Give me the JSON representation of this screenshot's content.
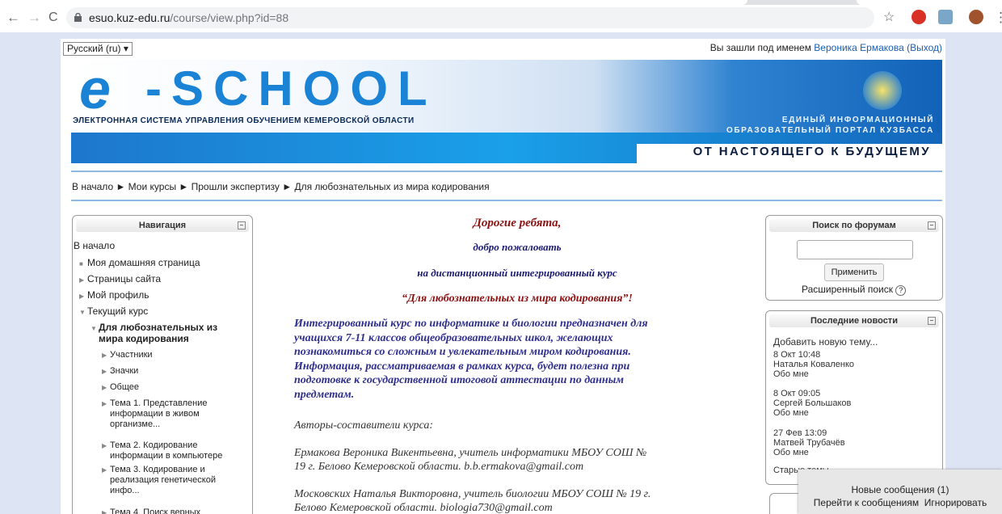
{
  "browser": {
    "url_host": "esuo.kuz-edu.ru",
    "url_path": "/course/view.php?id=88"
  },
  "lang_select": "Русский (ru) ▾",
  "login": {
    "prefix": "Вы зашли под именем ",
    "user": "Вероника Ермакова",
    "logout": "(Выход)"
  },
  "banner": {
    "e": "e",
    "school": "-SCHOOL",
    "subtitle": "ЭЛЕКТРОННАЯ СИСТЕМА УПРАВЛЕНИЯ ОБУЧЕНИЕМ КЕМЕРОВСКОЙ ОБЛАСТИ",
    "right1": "ЕДИНЫЙ ИНФОРМАЦИОННЫЙ",
    "right2": "ОБРАЗОВАТЕЛЬНЫЙ ПОРТАЛ КУЗБАССА",
    "slogan": "ОТ НАСТОЯЩЕГО К БУДУЩЕМУ"
  },
  "breadcrumb": [
    "В начало",
    "Мои курсы",
    "Прошли экспертизу",
    "Для любознательных из мира кодирования"
  ],
  "nav": {
    "title": "Навигация",
    "home": "В начало",
    "items": [
      "Моя домашняя страница",
      "Страницы сайта",
      "Мой профиль",
      "Текущий курс"
    ],
    "course_line1": "Для любознательных из",
    "course_line2": "мира кодирования",
    "sub": [
      "Участники",
      "Значки",
      "Общее"
    ],
    "t1": [
      "Тема 1. Представление",
      "информации в живом",
      "организме..."
    ],
    "t2": [
      "Тема 2. Кодирование",
      "информации в компьютере"
    ],
    "t3": [
      "Тема 3. Кодирование и",
      "реализация генетической",
      "инфо..."
    ],
    "t4": "Тема 4. Поиск верных"
  },
  "center": {
    "l1": "Дорогие ребята,",
    "l2": "добро пожаловать",
    "l3": "на дистанционный интегрированный курс",
    "l4": "“Для любознательных из мира кодирования”!",
    "p": [
      "Интегрированный курс по информатике и биологии предназначен для",
      "учащихся 7-11 классов общеобразовательных школ, желающих",
      "познакомиться со сложным и увлекательным миром кодирования.",
      "Информация, рассматриваемая в рамках курса, будет полезна при",
      "подготовке к государственной итоговой аттестации по данным",
      "предметам."
    ],
    "authors": "Авторы-составители курса:",
    "a1": [
      "Ермакова Вероника Викентьевна, учитель информатики МБОУ СОШ №",
      "19 г. Белово Кемеровской области.  b.b.ermakova@gmail.com"
    ],
    "a2": [
      "Московских Наталья Викторовна, учитель биологии МБОУ СОШ № 19 г.",
      "Белово Кемеровской области.  biologia730@gmail.com"
    ]
  },
  "search": {
    "title": "Поиск по форумам",
    "button": "Применить",
    "advanced": "Расширенный поиск"
  },
  "news": {
    "title": "Последние новости",
    "add": "Добавить новую тему...",
    "items": [
      [
        "8 Окт 10:48",
        "Наталья Коваленко",
        "Обо мне"
      ],
      [
        "8 Окт 09:05",
        "Сергей Большаков",
        "Обо мне"
      ],
      [
        "27 Фев 13:09",
        "Матвей Трубачёв",
        "Обо мне"
      ]
    ],
    "older": "Старые темы..."
  },
  "popup": {
    "title": "Новые сообщения (1)",
    "go": "Перейти к сообщениям",
    "ignore": "Игнорировать"
  }
}
